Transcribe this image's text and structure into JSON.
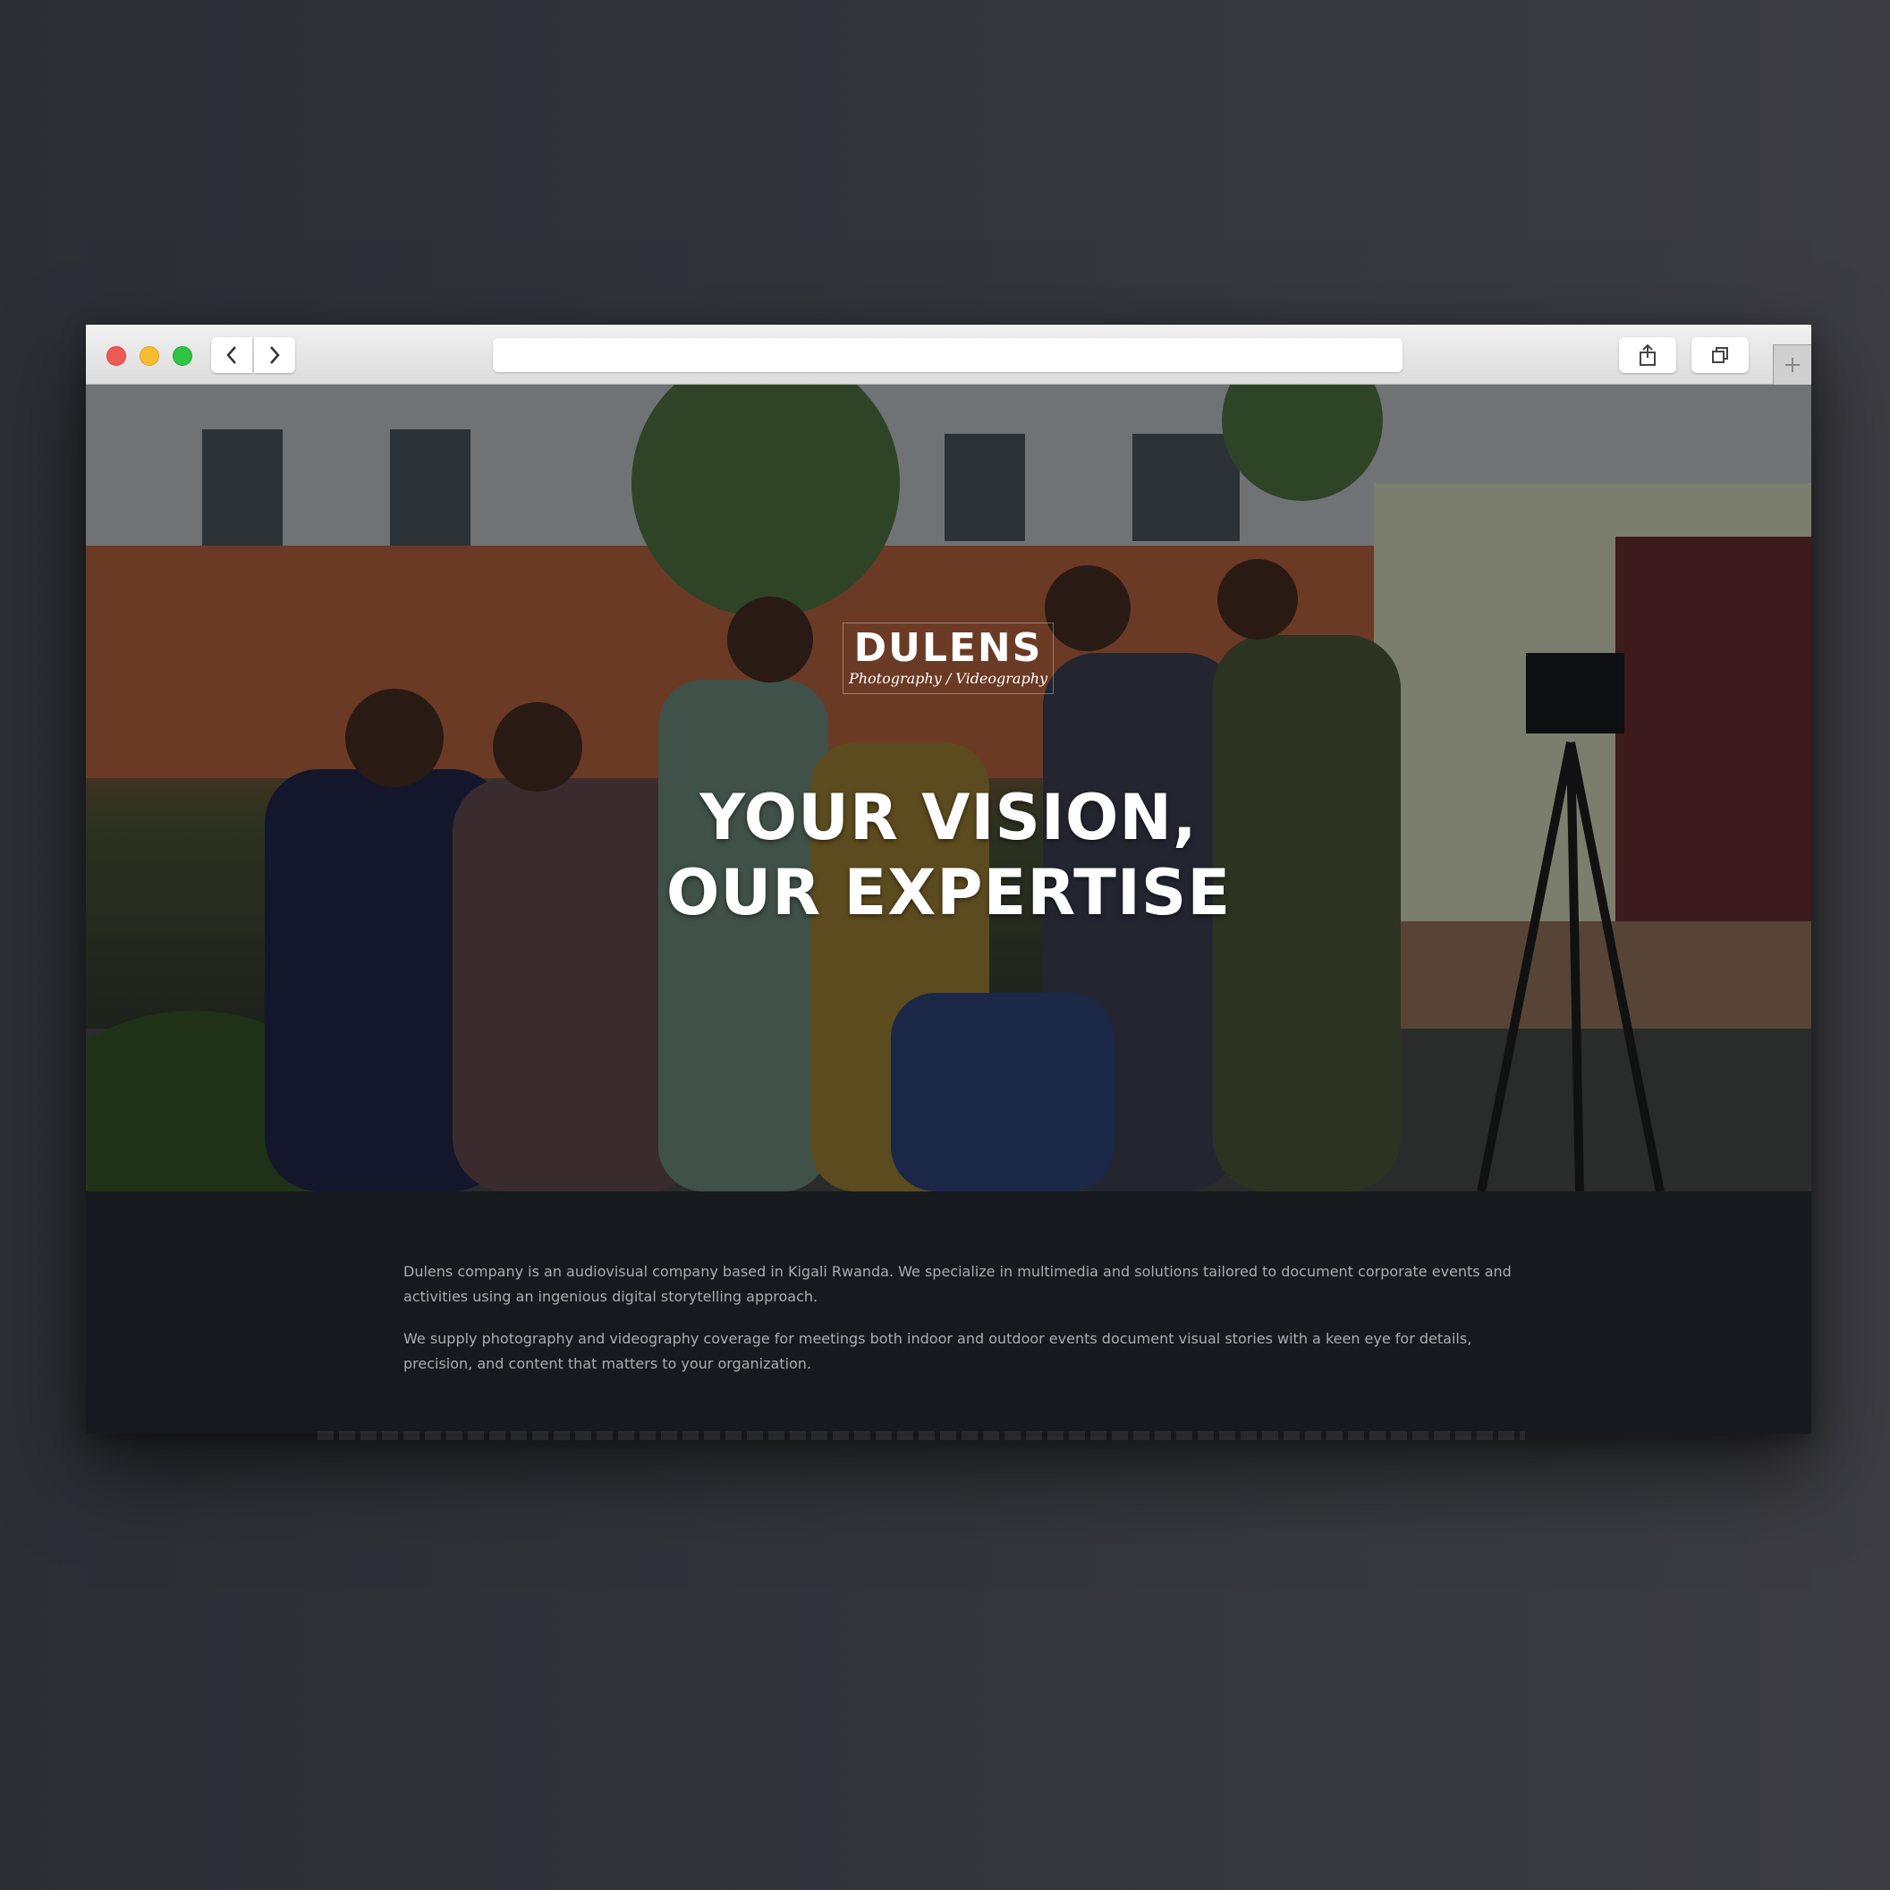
{
  "browser": {
    "url": "",
    "buttons": {
      "back": "chevron-left-icon",
      "forward": "chevron-right-icon",
      "share": "share-icon",
      "tabs": "tabs-icon",
      "new_tab": "plus-icon"
    },
    "traffic_lights": {
      "close": "#ee5a55",
      "minimize": "#f5bd2f",
      "zoom": "#2fc442"
    }
  },
  "hero": {
    "logo_title": "DULENS",
    "logo_subtitle": "Photography / Videography",
    "headline_line1": "YOUR VISION,",
    "headline_line2": "OUR EXPERTISE"
  },
  "about": {
    "paragraph1": "Dulens company is an audiovisual company based in Kigali Rwanda. We specialize in multimedia and solutions tailored to document corporate events and activities using an ingenious digital storytelling approach.",
    "paragraph2": "We supply photography and videography coverage for meetings both indoor and outdoor events document visual stories with a keen eye for details, precision, and content that matters to your organization."
  },
  "colors": {
    "background": "#2f3237",
    "page_background": "#16191d",
    "text": "#a9adb2"
  }
}
